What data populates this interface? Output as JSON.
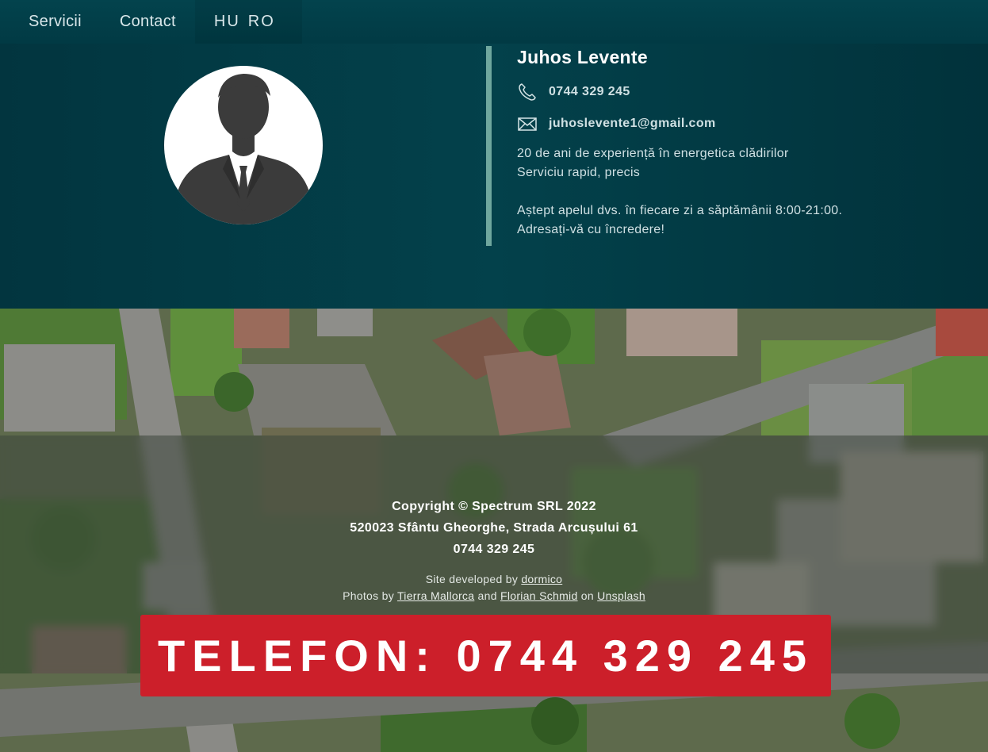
{
  "nav": {
    "items": [
      {
        "label": "Servicii"
      },
      {
        "label": "Contact"
      }
    ],
    "languages": [
      "HU",
      "RO"
    ]
  },
  "profile": {
    "name": "Juhos Levente",
    "phone": "0744 329 245",
    "email": "juhoslevente1@gmail.com",
    "description": [
      "20 de ani de experiență în energetica clădirilor",
      "Serviciu rapid, precis",
      "Aștept apelul dvs. în fiecare zi a săptămânii 8:00-21:00.",
      "Adresați-vă cu încredere!"
    ],
    "icons": {
      "phone": "phone-icon",
      "email": "envelope-icon",
      "avatar": "person-silhouette-icon"
    }
  },
  "footer": {
    "copyright": "Copyright © Spectrum SRL 2022",
    "address": "520023 Sfântu Gheorghe, Strada Arcușului 61",
    "phone": "0744 329 245",
    "developed_prefix": "Site developed by",
    "developer": "dormico",
    "photos_prefix": "Photos by",
    "photographer1": "Tierra Mallorca",
    "and": "and",
    "photographer2": "Florian Schmid",
    "on": "on",
    "source": "Unsplash"
  },
  "cta": {
    "label": "TELEFON: 0744 329 245",
    "color": "#cc1f2a"
  },
  "colors": {
    "header": "#03434d",
    "profile_bg": "#03414b",
    "divider": "#6fa79e"
  }
}
